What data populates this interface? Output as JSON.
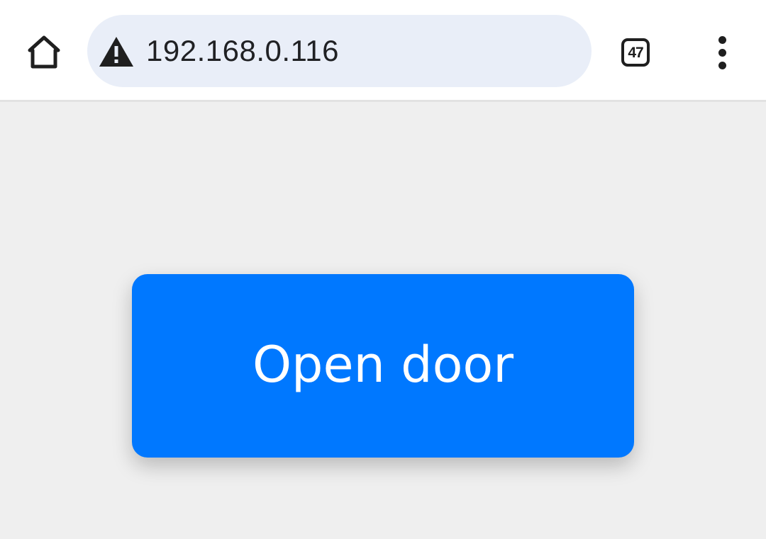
{
  "browser": {
    "address_bar": {
      "url": "192.168.0.116",
      "security_icon": "warning-triangle-icon"
    },
    "home_icon": "home-icon",
    "tab_count": "47",
    "menu_icon": "more-vert-icon"
  },
  "page": {
    "button_label": "Open door"
  },
  "colors": {
    "toolbar_bg": "#ffffff",
    "omnibox_bg": "#e9eef8",
    "page_bg": "#efefef",
    "button_bg": "#0078ff",
    "button_text": "#ffffff"
  }
}
